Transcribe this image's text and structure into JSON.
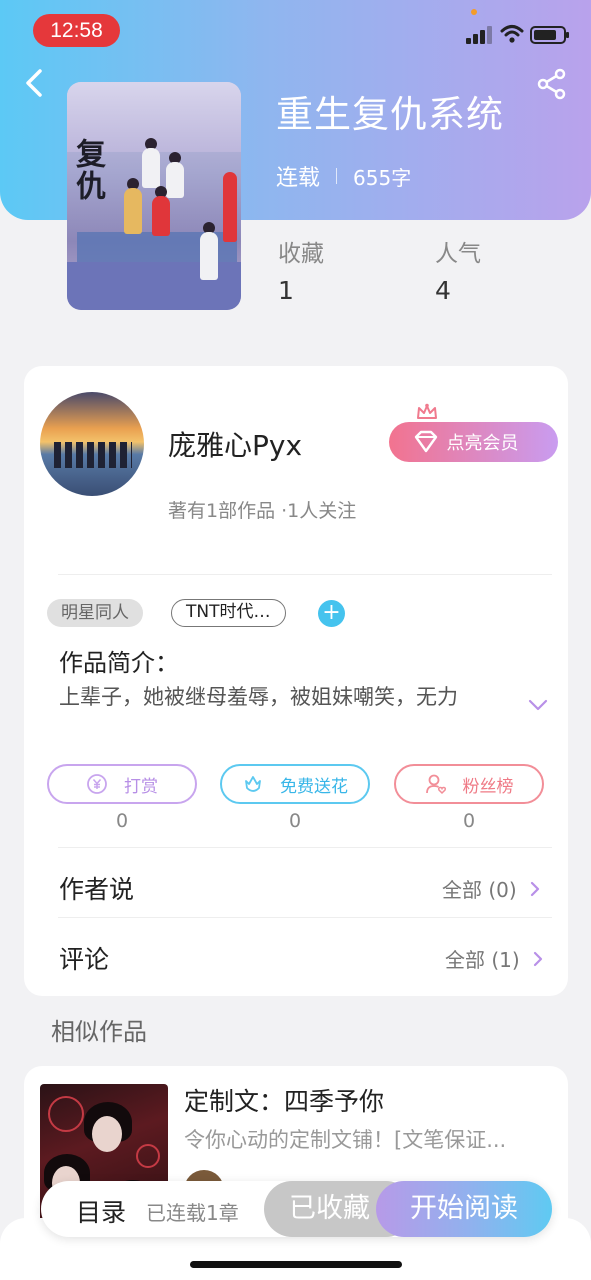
{
  "status": {
    "time": "12:58"
  },
  "book": {
    "title": "重生复仇系统",
    "cover_title": "复仇",
    "status": "连载",
    "word_count": "655字",
    "stats": [
      {
        "label": "收藏",
        "value": "1"
      },
      {
        "label": "人气",
        "value": "4"
      }
    ]
  },
  "author": {
    "name": "庞雅心Pyx",
    "subtitle": "著有1部作品 ·1人关注",
    "vip_label": "点亮会员"
  },
  "tags": [
    "明星同人",
    "TNT时代…"
  ],
  "intro": {
    "title": "作品简介：",
    "text": "上辈子，她被继母羞辱，被姐妹嘲笑，无力"
  },
  "actions": [
    {
      "label": "打赏",
      "count": "0"
    },
    {
      "label": "免费送花",
      "count": "0"
    },
    {
      "label": "粉丝榜",
      "count": "0"
    }
  ],
  "rows": [
    {
      "label": "作者说",
      "value": "全部 (0)"
    },
    {
      "label": "评论",
      "value": "全部 (1)"
    }
  ],
  "similar": {
    "section_title": "相似作品",
    "title": "定制文：四季予你",
    "desc": "令你心动的定制文铺！[文笔保证..."
  },
  "bottom": {
    "toc_label": "目录",
    "toc_sub": "已连载1章",
    "fav_label": "已收藏",
    "read_label": "开始阅读"
  },
  "colors": {
    "header_gradient": [
      "#5cc9f5",
      "#b9a2ec"
    ],
    "vip_gradient": [
      "#f2738f",
      "#c99cf0"
    ],
    "time_pill": "#e5383b"
  }
}
